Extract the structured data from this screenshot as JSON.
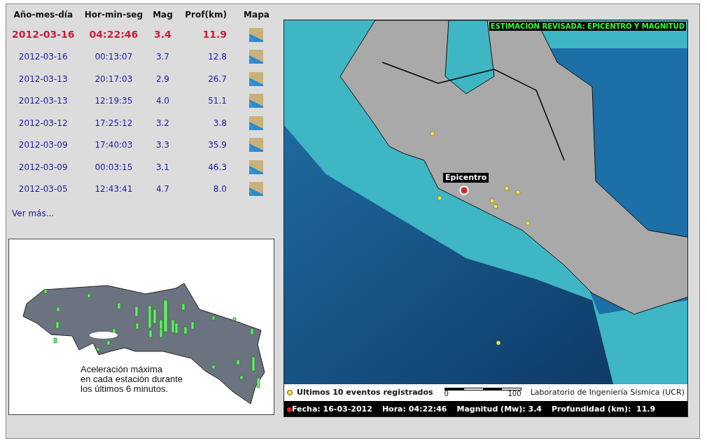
{
  "table": {
    "columns": [
      "Año-mes-día",
      "Hor-min-seg",
      "Mag",
      "Prof(km)",
      "Mapa"
    ],
    "rows": [
      {
        "date": "2012-03-16",
        "time": "04:22:46",
        "mag": "3.4",
        "depth": "11.9",
        "highlighted": true
      },
      {
        "date": "2012-03-16",
        "time": "00:13:07",
        "mag": "3.7",
        "depth": "12.8",
        "highlighted": false
      },
      {
        "date": "2012-03-13",
        "time": "20:17:03",
        "mag": "2.9",
        "depth": "26.7",
        "highlighted": false
      },
      {
        "date": "2012-03-13",
        "time": "12:19:35",
        "mag": "4.0",
        "depth": "51.1",
        "highlighted": false
      },
      {
        "date": "2012-03-12",
        "time": "17:25:12",
        "mag": "3.2",
        "depth": "3.8",
        "highlighted": false
      },
      {
        "date": "2012-03-09",
        "time": "17:40:03",
        "mag": "3.3",
        "depth": "35.9",
        "highlighted": false
      },
      {
        "date": "2012-03-09",
        "time": "00:03:15",
        "mag": "3.1",
        "depth": "46.3",
        "highlighted": false
      },
      {
        "date": "2012-03-05",
        "time": "12:43:41",
        "mag": "4.7",
        "depth": "8.0",
        "highlighted": false
      }
    ]
  },
  "more_link": "Ver más...",
  "acceleration_map": {
    "caption_lines": [
      "Aceleración máxima",
      "en cada estación durante",
      "los últimos 6 minutos."
    ]
  },
  "epicenter_map": {
    "title": "ESTIMACION REVISADA: EPICENTRO Y MAGNITUD",
    "epicenter_label": "Epicentro",
    "legend": "Ultimos 10 eventos registrados",
    "scale_start": "0",
    "scale_end": "100",
    "credit": "Laboratorio de Ingeniería Sísmica (UCR)",
    "info": [
      "Fecha: 16-03-2012",
      "Hora: 04:22:46",
      "Magnitud (Mw): 3.4",
      "Profundidad (km):  11.9"
    ]
  }
}
